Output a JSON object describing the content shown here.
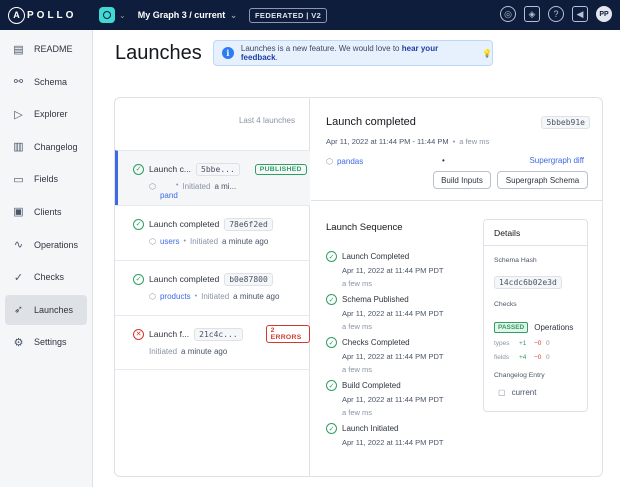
{
  "topbar": {
    "logo_text": "APOLLO",
    "graph_name": "My Graph 3 / current",
    "federation_badge": "FEDERATED | V2",
    "icons": [
      "graph-icon",
      "cube-icon",
      "help-icon",
      "announcements-icon"
    ],
    "avatar_initials": "PP"
  },
  "sidebar": {
    "items": [
      {
        "label": "README",
        "icon": "readme-icon"
      },
      {
        "label": "Schema",
        "icon": "schema-icon"
      },
      {
        "label": "Explorer",
        "icon": "explorer-icon"
      },
      {
        "label": "Changelog",
        "icon": "changelog-icon"
      },
      {
        "label": "Fields",
        "icon": "fields-icon"
      },
      {
        "label": "Clients",
        "icon": "clients-icon"
      },
      {
        "label": "Operations",
        "icon": "operations-icon"
      },
      {
        "label": "Checks",
        "icon": "checks-icon"
      },
      {
        "label": "Launches",
        "icon": "launches-icon",
        "active": true
      },
      {
        "label": "Settings",
        "icon": "settings-icon"
      }
    ]
  },
  "page": {
    "title": "Launches",
    "banner_text": "Launches is a new feature. We would love to ",
    "banner_link": "hear your feedback",
    "banner_end": "."
  },
  "list": {
    "count_label": "Last 4 launches",
    "launches": [
      {
        "title": "Launch c...",
        "hash": "5bbe...",
        "badge": "PUBLISHED",
        "status": "success",
        "subgraph": "pand",
        "initiated": "Initiated",
        "time": "a mi..."
      },
      {
        "title": "Launch completed",
        "hash": "78e6f2ed",
        "status": "success",
        "subgraph": "users",
        "initiated": "Initiated",
        "time": "a minute ago"
      },
      {
        "title": "Launch completed",
        "hash": "b0e87800",
        "status": "success",
        "subgraph": "products",
        "initiated": "Initiated",
        "time": "a minute ago"
      },
      {
        "title": "Launch f...",
        "hash": "21c4c...",
        "badge": "2 ERRORS",
        "status": "error",
        "initiated": "Initiated",
        "time": "a minute ago"
      }
    ]
  },
  "detail": {
    "title": "Launch completed",
    "hash": "5bbeb91e",
    "date": "Apr 11, 2022 at 11:44 PM - 11:44 PM",
    "ago": "a few ms",
    "subgraph": "pandas",
    "dot": "•",
    "supergraph_diff": "Supergraph diff",
    "build_inputs": "Build Inputs",
    "supergraph_schema": "Supergraph Schema",
    "sequence_title": "Launch Sequence",
    "steps": [
      {
        "name": "Launch Completed",
        "date": "Apr 11, 2022 at 11:44 PM PDT",
        "ago": "a few ms"
      },
      {
        "name": "Schema Published",
        "date": "Apr 11, 2022 at 11:44 PM PDT",
        "ago": "a few ms"
      },
      {
        "name": "Checks Completed",
        "date": "Apr 11, 2022 at 11:44 PM PDT",
        "ago": "a few ms"
      },
      {
        "name": "Build Completed",
        "date": "Apr 11, 2022 at 11:44 PM PDT",
        "ago": "a few ms"
      },
      {
        "name": "Launch Initiated",
        "date": "Apr 11, 2022 at 11:44 PM PDT"
      }
    ],
    "details_box": {
      "title": "Details",
      "schema_hash_label": "Schema Hash",
      "schema_hash": "14cdc6b02e3d",
      "checks_label": "Checks",
      "passed": "PASSED",
      "operations": "Operations",
      "types_label": "types",
      "types_plus": "+1",
      "types_minus": "−0",
      "types_zero": "0",
      "fields_label": "fields",
      "fields_plus": "+4",
      "fields_minus": "−0",
      "fields_zero": "0",
      "changelog_label": "Changelog Entry",
      "changelog_value": "current"
    }
  }
}
